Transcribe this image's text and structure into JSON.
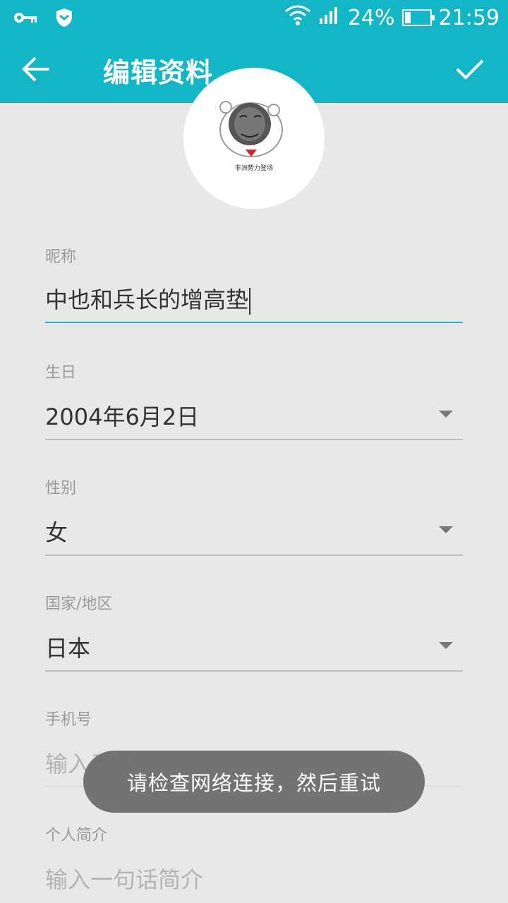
{
  "status_bar": {
    "battery_percent": "24%",
    "battery_level": 0.24,
    "time": "21:59",
    "icons": [
      "key-icon",
      "shield-icon",
      "wifi-icon",
      "signal-icon",
      "battery-icon"
    ]
  },
  "app_bar": {
    "title": "编辑资料",
    "back_icon": "arrow-left-icon",
    "confirm_icon": "check-icon"
  },
  "avatar": {
    "caption": "非洲势力登场"
  },
  "form": {
    "nickname": {
      "label": "昵称",
      "value": "中也和兵长的增高垫"
    },
    "birthday": {
      "label": "生日",
      "value": "2004年6月2日"
    },
    "gender": {
      "label": "性别",
      "value": "女"
    },
    "region": {
      "label": "国家/地区",
      "value": "日本"
    },
    "phone": {
      "label": "手机号",
      "placeholder": "输入手机号"
    },
    "bio": {
      "label": "个人简介",
      "placeholder": "输入一句话简介"
    }
  },
  "toast": {
    "message": "请检查网络连接，然后重试"
  },
  "colors": {
    "accent": "#13b6c6",
    "background": "#e8e8e8"
  }
}
